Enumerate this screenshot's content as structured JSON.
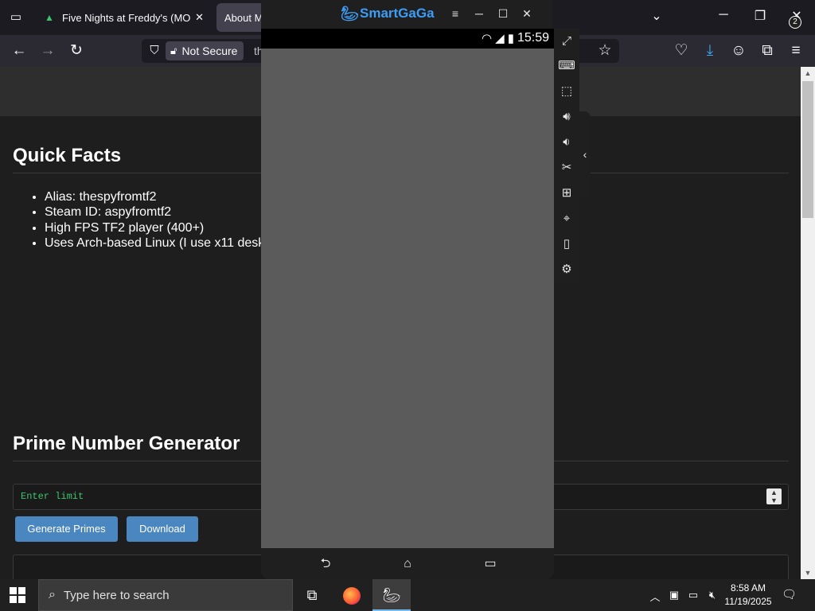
{
  "browser": {
    "tabs": [
      {
        "title": "Five Nights at Freddy's (MOD, U",
        "active": false
      },
      {
        "title": "About Me",
        "active": true
      }
    ],
    "url": {
      "security_label": "Not Secure",
      "visible_text": "th"
    },
    "icons": [
      "tab-list-icon",
      "back-icon",
      "forward-icon",
      "reload-icon",
      "shield-icon",
      "lock-warning-icon",
      "bookmark-star-icon",
      "pocket-icon",
      "download-icon",
      "account-icon",
      "extensions-icon",
      "menu-icon"
    ]
  },
  "page": {
    "quick_facts": {
      "title": "Quick Facts",
      "items": [
        "Alias: thespyfromtf2",
        "Steam ID: aspyfromtf2",
        "High FPS TF2 player (400+)",
        "Uses Arch-based Linux (I use x11 desk"
      ]
    },
    "prime_generator": {
      "title": "Prime Number Generator",
      "input_placeholder": "Enter limit",
      "generate_label": "Generate Primes",
      "download_label": "Download"
    }
  },
  "emulator": {
    "app_name": "SmartGaGa",
    "status_time": "15:59",
    "accent_color": "#3d9df6",
    "screen_color": "#5b5b5b",
    "toolbar_tools": [
      "fullscreen",
      "keyboard-mapping",
      "install-apk",
      "volume-up",
      "volume-down",
      "screenshot",
      "multi-instance",
      "location",
      "shake",
      "settings"
    ]
  },
  "taskbar": {
    "search_placeholder": "Type here to search",
    "clock_time": "8:58 AM",
    "clock_date": "11/19/2025",
    "notification_count": "2"
  }
}
